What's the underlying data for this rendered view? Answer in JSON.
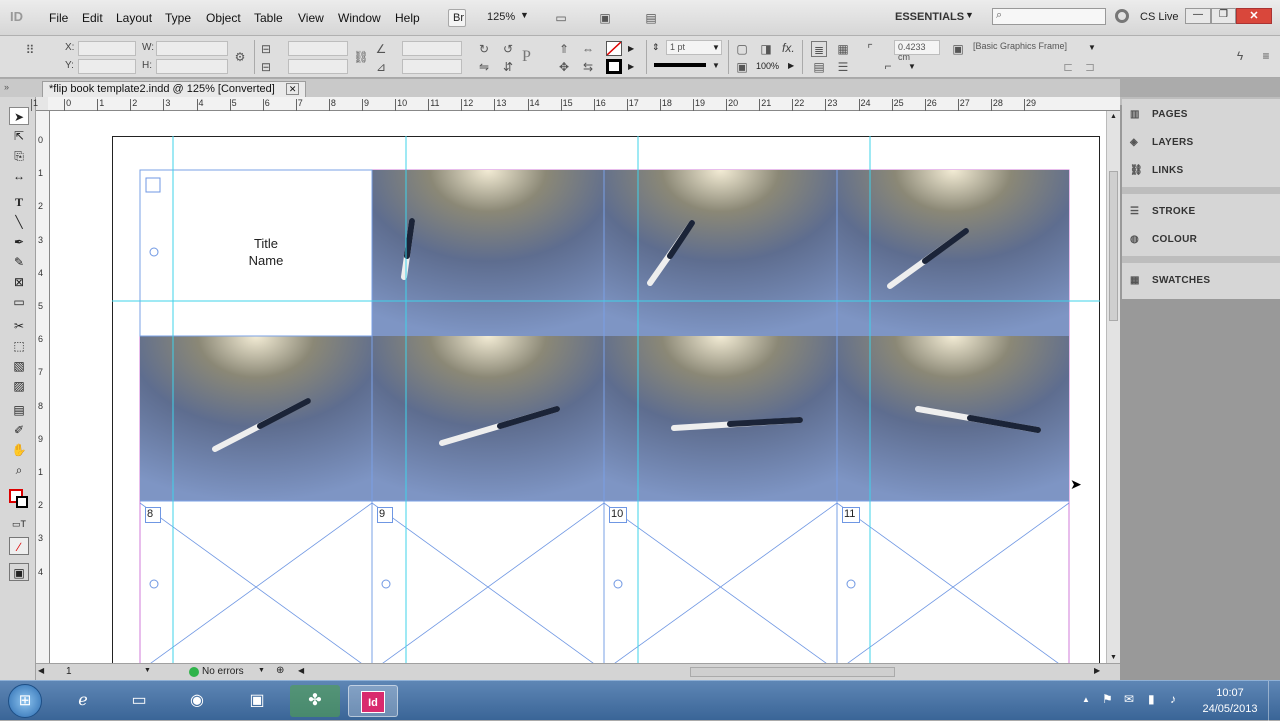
{
  "app": {
    "logo": "ID",
    "menus": [
      "File",
      "Edit",
      "Layout",
      "Type",
      "Object",
      "Table",
      "View",
      "Window",
      "Help"
    ],
    "bridge_label": "Br",
    "zoom": "125%",
    "workspace": "ESSENTIALS",
    "search_placeholder": "",
    "cslive": "CS Live"
  },
  "control": {
    "x_label": "X:",
    "y_label": "Y:",
    "w_label": "W:",
    "h_label": "H:",
    "stroke_weight": "1 pt",
    "scale": "100%",
    "offset": "0.4233 cm",
    "object_style": "[Basic Graphics Frame]"
  },
  "document": {
    "tab_title": "*flip book template2.indd @ 125% [Converted]",
    "ruler_labels": [
      "1",
      "0",
      "1",
      "2",
      "3",
      "4",
      "5",
      "6",
      "7",
      "8",
      "9",
      "10",
      "11",
      "12",
      "13",
      "14",
      "15",
      "16",
      "17",
      "18",
      "19",
      "20",
      "21",
      "22",
      "23",
      "24",
      "25",
      "26",
      "27",
      "28",
      "29"
    ],
    "vruler_labels": [
      "0",
      "1",
      "2",
      "3",
      "4",
      "5",
      "6",
      "7",
      "8",
      "9",
      "1",
      "2",
      "3",
      "4"
    ],
    "title_text": "Title",
    "name_text": "Name",
    "frame_numbers": [
      "8",
      "9",
      "10",
      "11"
    ]
  },
  "status": {
    "page": "1",
    "errors": "No errors"
  },
  "panels": [
    {
      "label": "PAGES",
      "icon": "pages-icon"
    },
    {
      "label": "LAYERS",
      "icon": "layers-icon"
    },
    {
      "label": "LINKS",
      "icon": "links-icon"
    },
    {
      "label": "STROKE",
      "icon": "stroke-icon"
    },
    {
      "label": "COLOUR",
      "icon": "colour-icon"
    },
    {
      "label": "SWATCHES",
      "icon": "swatches-icon"
    }
  ],
  "taskbar": {
    "time": "10:07",
    "date": "24/05/2013",
    "indesign_label": "Id"
  }
}
